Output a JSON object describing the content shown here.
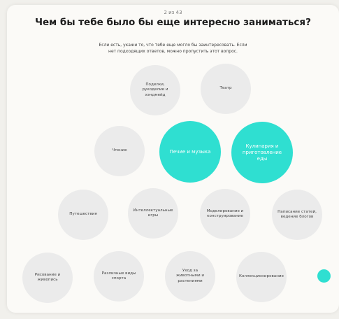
{
  "header": {
    "step": "2 из 43",
    "title": "Чем бы тебе было бы еще интересно заниматься?",
    "subtitle": "Если есть, укажи то, что тебе еще могло бы заинтересовать. Если нет подходящих ответов, можно пропустить этот вопрос."
  },
  "options": {
    "crafts": "Поделки, рукоделие и хэндмейд",
    "theatre": "Театр",
    "reading": "Чтение",
    "baking": "Печие и музыка",
    "cooking": "Кулинария и приготовление еды",
    "travel": "Путешествия",
    "games": "Интеллектуальные игры",
    "modeling": "Моделирование и конструирование",
    "blogging": "Написание статей, ведение блогов",
    "drawing": "Рисование и живопись",
    "sports": "Различные виды спорта",
    "animals": "Уход за животными и растениями",
    "collecting": "Коллекционирование"
  },
  "colors": {
    "accent": "#2fdfd1",
    "bubble": "#ebebeb"
  }
}
